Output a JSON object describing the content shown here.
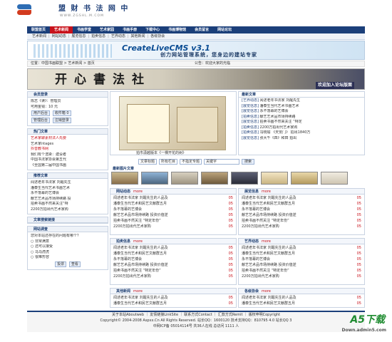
{
  "site": {
    "name": "盟 财 书 法 网 中",
    "url": "WWW.ZGSHL.M.COM"
  },
  "mainnav": [
    "联盟首页",
    "艺术新闻",
    "书画学堂",
    "艺术家园",
    "书画手册",
    "下载中心",
    "书画博物馆",
    "会员留言",
    "网站论坛"
  ],
  "subnav": [
    "艺术新闻",
    "网站动态",
    "展览信息",
    "拍卖信息",
    "艺界动态",
    "其他新闻",
    "各级协会"
  ],
  "banner": {
    "title": "CreateLiveCMS v3.1",
    "subtitle": "创力网站管理系统，您身边的建站专家"
  },
  "location": {
    "left": "位置：中国书画联盟 > 艺术新闻 > 首页",
    "right": "公告：欢迎大家的光临"
  },
  "calligraphy": {
    "text": "开心書法社",
    "badge": "欢迎加入论坛版面"
  },
  "login": {
    "title": "会员登录",
    "rows": [
      "陈志《读》：管理员",
      "可用金钱：10 元"
    ],
    "buttons": [
      "用户后台",
      "收件箱 0",
      "管理后台",
      "注销登录"
    ]
  },
  "hot": {
    "title": "热门文章",
    "rows": [
      "艺术家聊素材法人先要",
      "艺术家ntages",
      "抖音教书网",
      "我们有个渲染：建设者",
      "中国书法家协会第五代",
      "《全国第二届中国书画"
    ]
  },
  "recommend": {
    "title": "推荐文章",
    "rows": [
      "闻述老年书法家 刘醒先生",
      "潘泰生当代艺术书画艺术",
      "永不落幕的艺博会",
      "献艺艺术品市场持续路 投",
      "拍卖书画不然来关注“特",
      "2200万拍出代艺术家购"
    ]
  },
  "links": {
    "title": "文章搜索链接",
    "items": [],
    "survey_title": "网站调查",
    "survey_q": "您对本站还存在的问题有哪个？",
    "survey_opts": [
      "非常满意",
      "还可以接受",
      "马马虎虎",
      "很难形容"
    ],
    "survey_btns": [
      "投票",
      "查看"
    ]
  },
  "center": {
    "caption": "拍市潇越版本《一棵开花的树》"
  },
  "latest": {
    "title": "最新文章",
    "rows": [
      [
        "[艺界动态]",
        "闻述老年书法家 刘醒先生"
      ],
      [
        "[展览信息]",
        "潘泰生当代艺术书画艺术"
      ],
      [
        "[展览信息]",
        "永不落幕的艺博会"
      ],
      [
        "[拍卖信息]",
        "献艺艺术品市场持续路"
      ],
      [
        "[展览信息]",
        "拍卖书画不然来关注 “特定"
      ],
      [
        "[拍卖信息]",
        "2200万拍出代艺术家购"
      ],
      [
        "[拍卖信息]",
        "冯晓瑜 《天安门》 拍出1840万"
      ],
      [
        "[展览信息]",
        "张大千《四》和田 拍出"
      ]
    ]
  },
  "search": {
    "fields": [
      "文章标题",
      "所有栏目",
      "不指定专题",
      "关键字"
    ],
    "button": "搜索"
  },
  "pictures": {
    "title": "最新图片文章"
  },
  "sections": [
    {
      "title": "网站动态",
      "more": "more"
    },
    {
      "title": "展览信息",
      "more": "more"
    },
    {
      "title": "拍卖信息",
      "more": "more"
    },
    {
      "title": "艺界动态",
      "more": "more"
    },
    {
      "title": "其他新闻",
      "more": "more"
    },
    {
      "title": "各级协会",
      "more": "more"
    }
  ],
  "section_rows": [
    "闻述老年书法家 刘醒先生的人品及",
    "潘泰生当代艺术和民艺文献群五月",
    "永不落幕的艺博会",
    "献艺艺术品市场持续路 投资价值逆",
    "拍卖书画不然关注 “特定年份”",
    "2200万拍出代艺术家购"
  ],
  "section_dates": [
    "05",
    "05",
    "05",
    "05",
    "05",
    "05"
  ],
  "footer": {
    "line1": "关于本站Aboutweb ｜ 友情链接LinkSite ｜ 联系方式Contact ｜ 汇款方式Remit ｜ 版权申明Copyright",
    "line2": "Copyright© 2004-2008 Aspxx.Cn All Rights Reserved. 站长QQ：1600120 技术支持QQ：810795 4.0 站长QQ 3",
    "line3": "中网ICP备 05014114号 共36人在线 总访问 1111 人"
  },
  "watermark": {
    "big": "A5下载",
    "small": "Down.admin5.com"
  }
}
